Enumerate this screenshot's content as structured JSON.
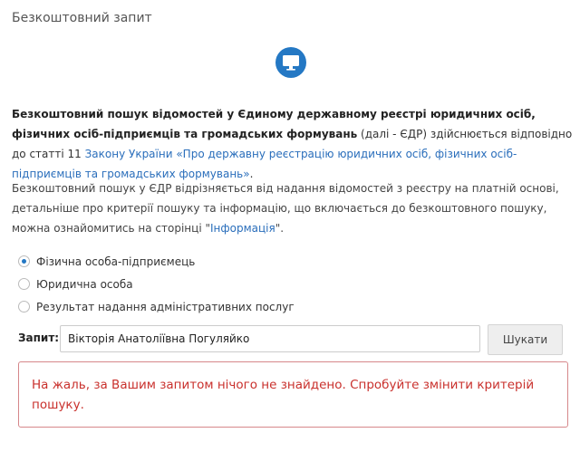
{
  "page": {
    "title": "Безкоштовний запит"
  },
  "intro": {
    "bold": "Безкоштовний пошук відомостей у Єдиному державному реєстрі юридичних осіб, фізичних осіб-підприємців та громадських формувань",
    "plain": " (далі - ЄДР) здійснюється відповідно до статті 11 ",
    "law_link": "Закону України «Про державну реєстрацію юридичних осіб, фізичних осіб-підприємців та громадських формувань»",
    "end": "."
  },
  "info": {
    "text": "Безкоштовний пошук у ЄДР відрізняється від надання відомостей з реєстру на платній основі, детальніше про критерії пошуку та інформацію, що включається до безкоштовного пошуку, можна ознайомитись на сторінці \"",
    "link": "Інформація",
    "end": "\"."
  },
  "search_type": {
    "options": [
      "Фізична особа-підприємець",
      "Юридична особа",
      "Результат надання адміністративних послуг"
    ],
    "selected": "Фізична особа-підприємець"
  },
  "query": {
    "label": "Запит:",
    "value": "Вікторія Анатоліївна Погуляйко",
    "button": "Шукати"
  },
  "result": {
    "message": "На жаль, за Вашим запитом нічого не знайдено. Спробуйте змінити критерій пошуку."
  },
  "colors": {
    "accent": "#2478c4",
    "link": "#2a6ebb",
    "error_text": "#c9302c",
    "error_border": "#d6878a"
  },
  "icons": {
    "header": "monitor-icon"
  }
}
